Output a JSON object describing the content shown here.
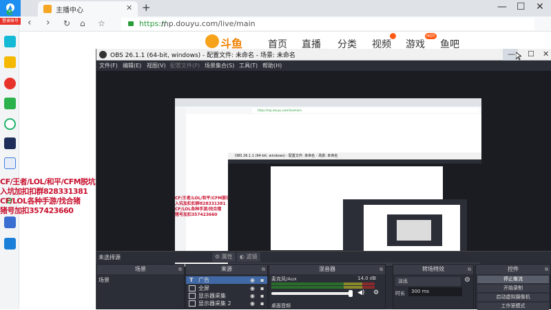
{
  "browser": {
    "tab_title": "主播中心",
    "tab_close": "✕",
    "new_tab": "+",
    "window_min": "—",
    "window_max": "☐",
    "window_close": "✕",
    "url_protocol": "https://",
    "url_rest": "mp.douyu.com/live/main"
  },
  "sidebar": {
    "login_label": "登录账号",
    "icon_colors": [
      "#2bb24c",
      "#14b9d6",
      "#f5b800",
      "#e8332b",
      "#2bb24c",
      "#20b26b",
      "#1f2d5a",
      "#3d7be0",
      "#2bb24c",
      "#d63b2f",
      "#3a6ed1",
      "#1a7fd8"
    ]
  },
  "douyu": {
    "logo_text": "斗鱼",
    "nav": [
      "首页",
      "直播",
      "分类",
      "视频",
      "游戏",
      "鱼吧"
    ],
    "badge_video": "",
    "badge_game": "HOT"
  },
  "overlay": {
    "line1": "CF/王者/LOL/和平/CFM脱坑",
    "line2": "入坑加扣扣群828331381",
    "line3": "CF/LOL各种手游/找合猪",
    "line4": "猪号加扣357423660"
  },
  "obs": {
    "title": "OBS 26.1.1 (64-bit, windows) - 配置文件: 未命名 - 场景: 未命名",
    "menu": [
      "文件(F)",
      "编辑(E)",
      "视图(V)",
      "配置文件(P)",
      "场景集合(S)",
      "工具(T)",
      "帮助(H)"
    ],
    "inner_title": "OBS 26.1.1 (64-bit, windows) - 配置文件: 未命名 - 场景: 未命名",
    "inner_url": "https://mp.douyu.com/live/main",
    "no_source": "未选择源",
    "props_btn": "⚙ 属性",
    "filters_btn": "◐ 滤镜",
    "scenes_header": "场景",
    "scene_name": "场景",
    "sources_header": "来源",
    "sources": [
      {
        "name": "广告",
        "type_icon": "T"
      },
      {
        "name": "全屏"
      },
      {
        "name": "显示器采集"
      },
      {
        "name": "显示器采集 2"
      }
    ],
    "mixer_header": "混音器",
    "mixer_track1": "麦克风/Aux",
    "mixer_db": "14.0 dB",
    "mixer_track2": "桌面音频",
    "trans_header": "转场特效",
    "trans_value": "淡出",
    "trans_duration_label": "时长",
    "trans_duration": "300 ms",
    "controls_header": "控件",
    "controls": [
      "停止推流",
      "开始录制",
      "启动虚拟摄像机",
      "工作室模式"
    ]
  }
}
